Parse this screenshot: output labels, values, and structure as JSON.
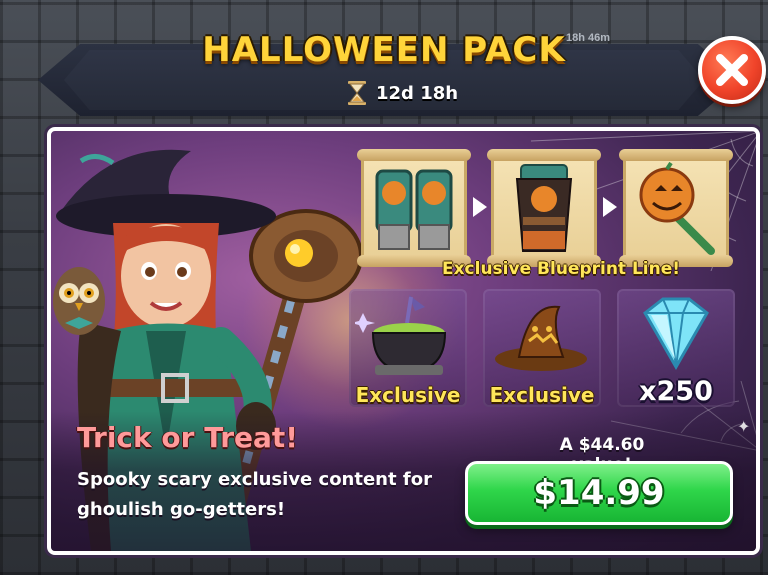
{
  "background": {
    "event_timer": "18h 46m"
  },
  "header": {
    "title": "HALLOWEEN PACK",
    "time_remaining": "12d 18h"
  },
  "close_icon": "close-x-icon",
  "blueprints": {
    "items": [
      "pumpkin-gauntlets-icon",
      "pumpkin-armor-icon",
      "pumpkin-staff-icon"
    ],
    "label": "Exclusive Blueprint Line!"
  },
  "rewards": [
    {
      "icon": "cauldron-icon",
      "label": "Exclusive"
    },
    {
      "icon": "witch-hat-icon",
      "label": "Exclusive"
    },
    {
      "icon": "gem-icon",
      "label": "x250"
    }
  ],
  "offer": {
    "tagline": "Trick or Treat!",
    "description_line1": "Spooky scary exclusive content for",
    "description_line2": "ghoulish go-getters!",
    "value_text": "A $44.60 value!",
    "price": "$14.99"
  },
  "colors": {
    "title": "#ffd43a",
    "buy_button": "#2fd64a",
    "close_button": "#f0442a",
    "tagline": "#ff9a9a",
    "panel": "#6e3e7e"
  }
}
